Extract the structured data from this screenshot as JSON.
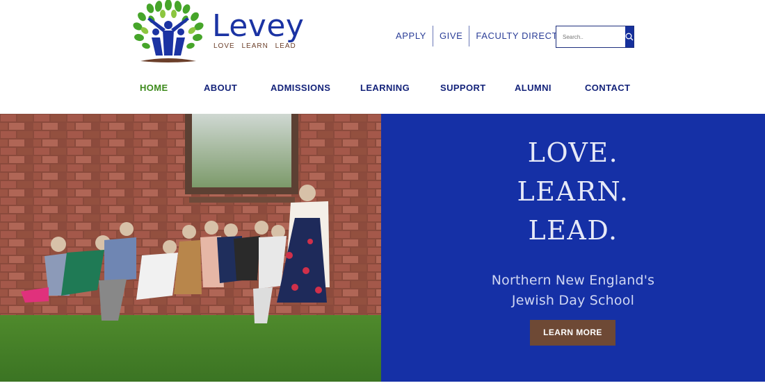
{
  "logo": {
    "wordmark": "Levey",
    "tagline": "LOVE   LEARN   LEAD"
  },
  "utility_nav": {
    "apply": "APPLY",
    "give": "GIVE",
    "faculty_directory": "FACULTY DIRECTORY"
  },
  "search": {
    "placeholder": "Search..",
    "icon": "magnifier-icon"
  },
  "main_nav": {
    "active": "HOME",
    "items": [
      "HOME",
      "ABOUT",
      "ADMISSIONS",
      "LEARNING",
      "SUPPORT",
      "ALUMNI",
      "CONTACT"
    ]
  },
  "hero": {
    "slogan": [
      "LOVE.",
      "LEARN.",
      "LEAD."
    ],
    "subtitle": [
      "Northern New England's",
      "Jewish Day School"
    ],
    "cta": "LEARN MORE"
  },
  "colors": {
    "brand_blue": "#1530a6",
    "nav_text": "#14237a",
    "active_green": "#3d8a1c",
    "cta_brown": "#6e4935"
  }
}
